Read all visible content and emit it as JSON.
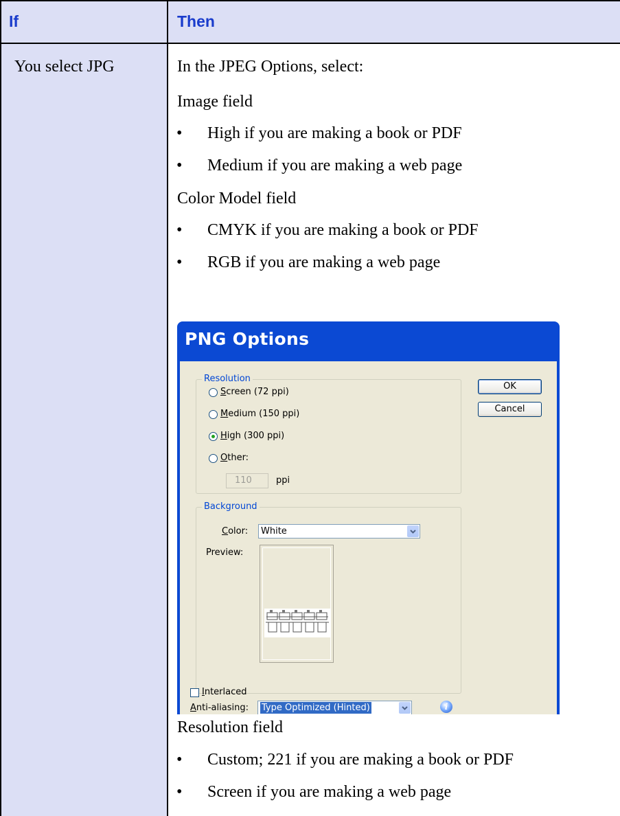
{
  "header": {
    "col_if": "If",
    "col_then": "Then"
  },
  "row": {
    "if_text": "You select JPG",
    "intro": "In the JPEG Options, select:",
    "image_field": {
      "label": "Image field",
      "bullets": [
        "High if you are making a book or PDF",
        "Medium if you are making a web page"
      ]
    },
    "color_model_field": {
      "label": "Color Model field",
      "bullets": [
        "CMYK if you are making a book or PDF",
        "RGB if you are making a web page"
      ]
    },
    "resolution_field": {
      "label": "Resolution field",
      "bullets": [
        "Custom; 221 if you are making a book or PDF",
        "Screen if you are making a web page"
      ]
    },
    "bullet_glyph": "•"
  },
  "dialog": {
    "title": "PNG Options",
    "resolution": {
      "legend": "Resolution",
      "options": [
        {
          "pre": "",
          "u": "S",
          "post": "creen (72 ppi)",
          "selected": false
        },
        {
          "pre": "",
          "u": "M",
          "post": "edium (150 ppi)",
          "selected": false
        },
        {
          "pre": "",
          "u": "H",
          "post": "igh (300 ppi)",
          "selected": true
        },
        {
          "pre": "",
          "u": "O",
          "post": "ther:",
          "selected": false
        }
      ],
      "other_value": "110",
      "other_unit": "ppi"
    },
    "background": {
      "legend": "Background",
      "color_label_u": "C",
      "color_label_rest": "olor:",
      "color_value": "White",
      "preview_label": "Preview:"
    },
    "anti_aliasing": {
      "label_u": "A",
      "label_rest": "nti-aliasing:",
      "value": "Type Optimized (Hinted)"
    },
    "interlaced": {
      "label_u": "I",
      "label_rest": "nterlaced",
      "checked": false
    },
    "buttons": {
      "ok": "OK",
      "cancel": "Cancel"
    },
    "info_glyph": "i",
    "colors": {
      "title_bar": "#0b49d3",
      "face": "#ece9d8",
      "legend": "#0046d5",
      "selection": "#316ac5"
    }
  },
  "colors": {
    "header_bg": "#dcdff5",
    "header_text": "#1a3ccc"
  }
}
